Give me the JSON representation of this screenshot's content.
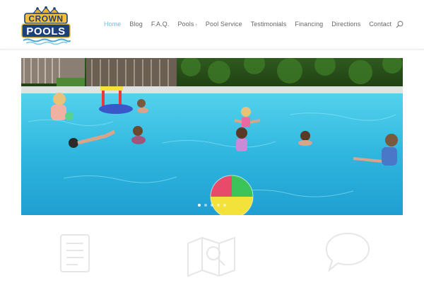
{
  "logo": {
    "top_text": "CROWN",
    "bottom_text": "POOLS"
  },
  "nav": {
    "items": [
      {
        "label": "Home",
        "active": true
      },
      {
        "label": "Blog"
      },
      {
        "label": "F.A.Q."
      },
      {
        "label": "Pools",
        "has_submenu": true
      },
      {
        "label": "Pool Service"
      },
      {
        "label": "Testimonials"
      },
      {
        "label": "Financing"
      },
      {
        "label": "Directions"
      },
      {
        "label": "Contact"
      }
    ],
    "submenu_caret": "›",
    "active_color": "#7ab8d4",
    "search_icon": "search-icon"
  },
  "slider": {
    "slide_count": 5,
    "active_slide": 1
  },
  "features": {
    "icons": [
      "document-icon",
      "map-search-icon",
      "chat-bubble-icon"
    ]
  }
}
